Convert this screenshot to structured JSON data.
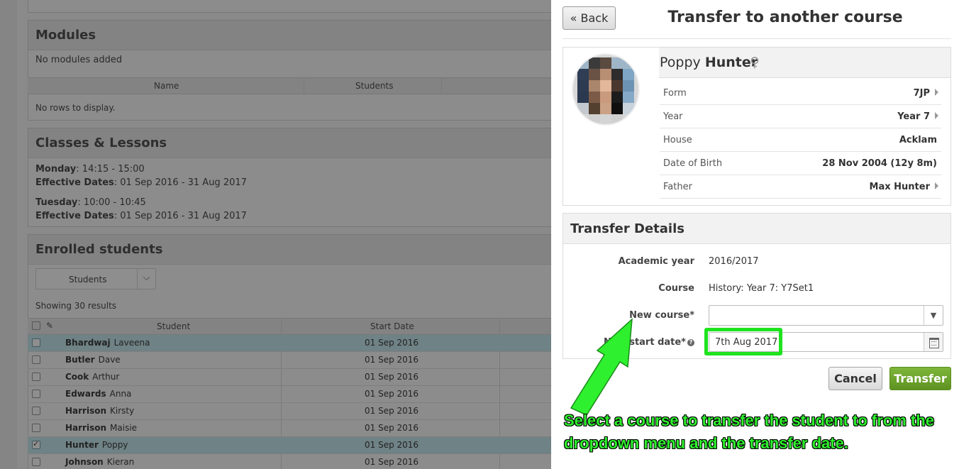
{
  "background_page": {
    "modules": {
      "title": "Modules",
      "empty_text": "No modules added",
      "columns": [
        "Name",
        "Students"
      ],
      "no_rows": "No rows to display."
    },
    "classes": {
      "title": "Classes & Lessons",
      "lessons": [
        {
          "day": "Monday",
          "time": ": 14:15 - 15:00",
          "dates_label": "Effective Dates",
          "dates": ": 01 Sep 2016 - 31 Aug 2017"
        },
        {
          "day": "Tuesday",
          "time": ": 10:00 - 10:45",
          "dates_label": "Effective Dates",
          "dates": ": 01 Sep 2016 - 31 Aug 2017"
        }
      ]
    },
    "enrolled": {
      "title": "Enrolled students",
      "view_select": "Students",
      "count_text": "Showing 30 results",
      "columns": [
        "Student",
        "Start Date"
      ],
      "rows": [
        {
          "surname": "Bhardwaj",
          "forename": "Laveena",
          "start": "01 Sep 2016",
          "highlighted": true,
          "checked": false
        },
        {
          "surname": "Butler",
          "forename": "Dave",
          "start": "01 Sep 2016",
          "highlighted": false,
          "checked": false
        },
        {
          "surname": "Cook",
          "forename": "Arthur",
          "start": "01 Sep 2016",
          "highlighted": false,
          "checked": false
        },
        {
          "surname": "Edwards",
          "forename": "Anna",
          "start": "01 Sep 2016",
          "highlighted": false,
          "checked": false
        },
        {
          "surname": "Harrison",
          "forename": "Kirsty",
          "start": "01 Sep 2016",
          "highlighted": false,
          "checked": false
        },
        {
          "surname": "Harrison",
          "forename": "Maisie",
          "start": "01 Sep 2016",
          "highlighted": false,
          "checked": false
        },
        {
          "surname": "Hunter",
          "forename": "Poppy",
          "start": "01 Sep 2016",
          "highlighted": true,
          "checked": true
        },
        {
          "surname": "Johnson",
          "forename": "Kieran",
          "start": "01 Sep 2016",
          "highlighted": false,
          "checked": false
        }
      ]
    }
  },
  "drawer": {
    "back_label": "« Back",
    "title": "Transfer to another course",
    "student": {
      "forename": "Poppy",
      "surname": "Hunter",
      "gender_icon": "female-icon",
      "fields": [
        {
          "label": "Form",
          "value": "7JP",
          "link": true
        },
        {
          "label": "Year",
          "value": "Year 7",
          "link": true
        },
        {
          "label": "House",
          "value": "Acklam",
          "link": false
        },
        {
          "label": "Date of Birth",
          "value": "28 Nov 2004 (12y 8m)",
          "link": false
        },
        {
          "label": "Father",
          "value": "Max Hunter",
          "link": true
        }
      ]
    },
    "transfer": {
      "title": "Transfer Details",
      "academic_year_label": "Academic year",
      "academic_year": "2016/2017",
      "course_label": "Course",
      "course": "History: Year 7: Y7Set1",
      "new_course_label": "New course*",
      "new_course_value": "",
      "new_start_label": "New start date*",
      "new_start_value": "7th Aug 2017"
    },
    "cancel_label": "Cancel",
    "transfer_label": "Transfer"
  },
  "annotation": {
    "text": "Select a course to transfer the student to from the dropdown menu and the transfer date.",
    "color": "#2ef02e"
  },
  "colors": {
    "overlay": "#8a8a8a",
    "transfer_button": "#6ea62e",
    "highlight": "#1ee31e"
  }
}
